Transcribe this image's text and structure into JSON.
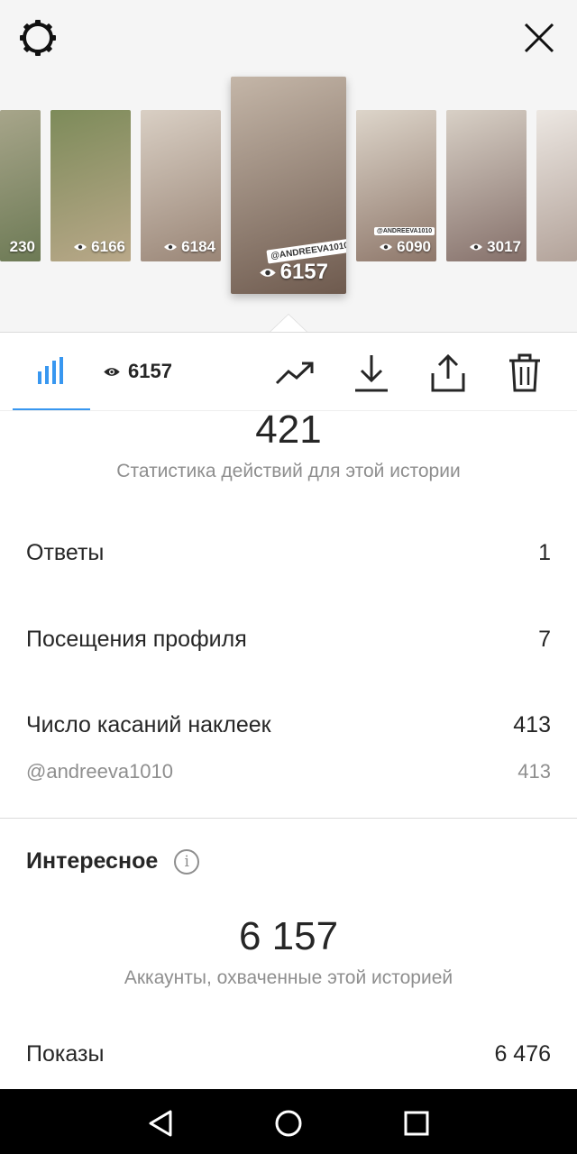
{
  "toolbar": {
    "gear_icon": "gear-icon",
    "close_icon": "close-icon"
  },
  "stories": [
    {
      "views": "230",
      "colors": [
        "#a7a58a",
        "#6d7a55"
      ]
    },
    {
      "views": "6166",
      "colors": [
        "#7d8b5a",
        "#b9a889"
      ]
    },
    {
      "views": "6184",
      "colors": [
        "#d9cfc4",
        "#9a8677"
      ]
    },
    {
      "views": "6157",
      "colors": [
        "#c4b6a8",
        "#6e5a4e"
      ],
      "selected": true,
      "sticker": "@ANDREEVA1010"
    },
    {
      "views": "6090",
      "colors": [
        "#ddd5ca",
        "#8e776a"
      ],
      "sticker": "@ANDREEVA1010"
    },
    {
      "views": "3017",
      "colors": [
        "#d8d0c6",
        "#85706a"
      ]
    },
    {
      "views": "",
      "colors": [
        "#ece7e2",
        "#b3a39a"
      ]
    }
  ],
  "tabs": {
    "views_count": "6157"
  },
  "interactions": {
    "total": "421",
    "caption": "Статистика действий для этой истории",
    "rows": [
      {
        "label": "Ответы",
        "value": "1"
      },
      {
        "label": "Посещения профиля",
        "value": "7"
      },
      {
        "label": "Число касаний наклеек",
        "value": "413"
      }
    ],
    "sticker_row": {
      "label": "@andreeva1010",
      "value": "413"
    }
  },
  "discovery": {
    "title": "Интересное",
    "reach": "6 157",
    "reach_caption": "Аккаунты, охваченные этой историей",
    "impressions_label": "Показы",
    "impressions_value": "6 476"
  },
  "colors": {
    "accent": "#3897f0",
    "text": "#262626",
    "muted": "#8e8e8e"
  }
}
